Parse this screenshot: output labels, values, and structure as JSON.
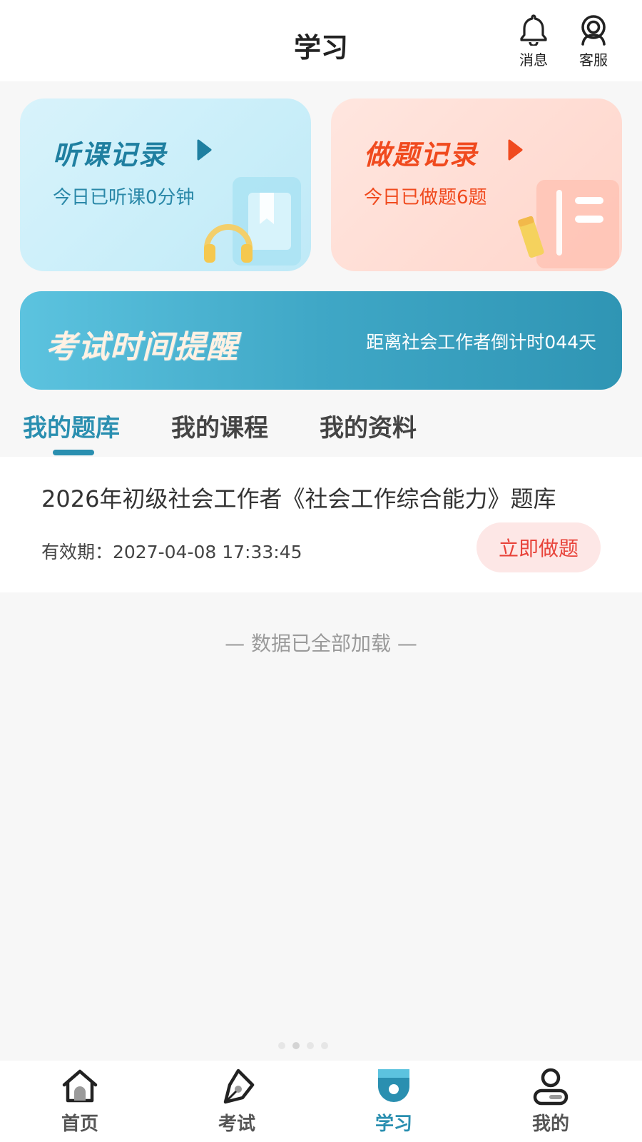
{
  "header": {
    "title": "学习",
    "actions": [
      {
        "label": "消息",
        "icon": "bell-icon"
      },
      {
        "label": "客服",
        "icon": "headset-icon"
      }
    ]
  },
  "cards": {
    "listen": {
      "title": "听课记录",
      "subtitle": "今日已听课0分钟",
      "color": "#1f7fa0"
    },
    "practice": {
      "title": "做题记录",
      "subtitle": "今日已做题6题",
      "color": "#f04a1e"
    }
  },
  "reminder": {
    "title": "考试时间提醒",
    "countdown": "距离社会工作者倒计时044天"
  },
  "tabs": [
    {
      "label": "我的题库",
      "active": true
    },
    {
      "label": "我的课程",
      "active": false
    },
    {
      "label": "我的资料",
      "active": false
    }
  ],
  "bank_item": {
    "title": "2026年初级社会工作者《社会工作综合能力》题库",
    "validity": "有效期：2027-04-08 17:33:45",
    "button": "立即做题"
  },
  "list_end_note": "— 数据已全部加载 —",
  "bottom_nav": [
    {
      "label": "首页",
      "icon": "home-icon",
      "active": false
    },
    {
      "label": "考试",
      "icon": "pen-icon",
      "active": false
    },
    {
      "label": "学习",
      "icon": "study-icon",
      "active": true
    },
    {
      "label": "我的",
      "icon": "profile-icon",
      "active": false
    }
  ],
  "colors": {
    "accent": "#2a8fb0",
    "danger": "#e8433a"
  }
}
